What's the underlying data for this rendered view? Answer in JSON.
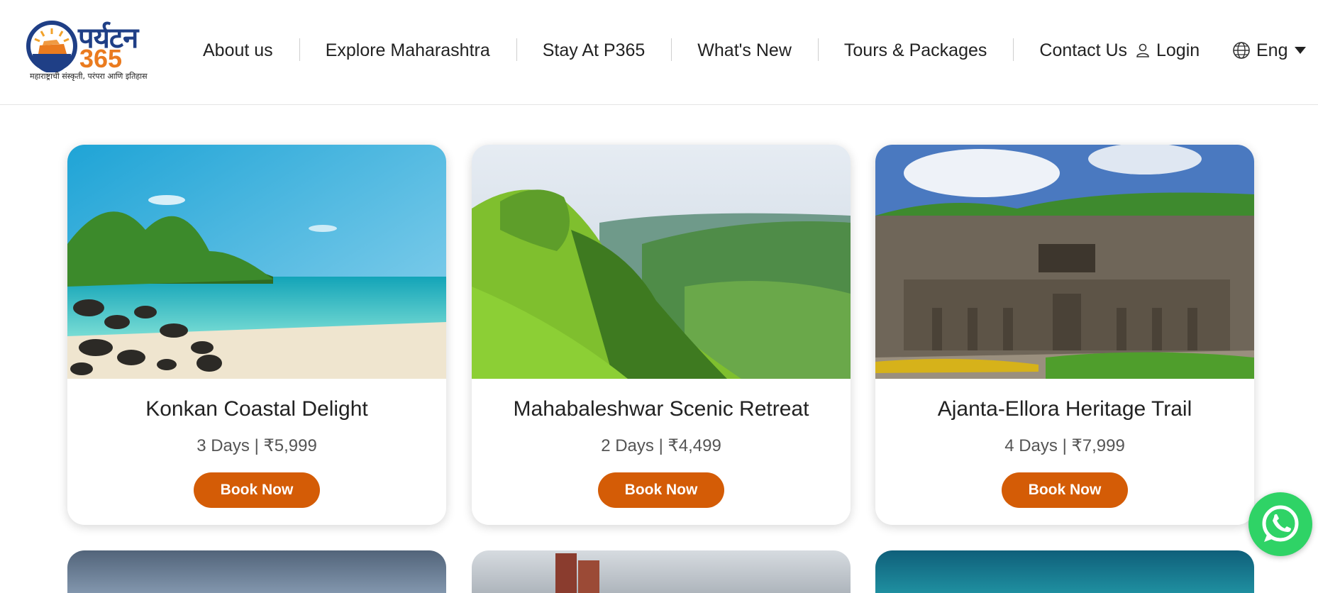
{
  "brand": {
    "title": "पर्यटन",
    "number": "365",
    "tagline": "महाराष्ट्राची संस्कृती, परंपरा आणि इतिहास",
    "colors": {
      "navy": "#1f3f86",
      "orange": "#ea7b1f"
    }
  },
  "nav": {
    "items": [
      "About us",
      "Explore Maharashtra",
      "Stay At P365",
      "What's New",
      "Tours & Packages",
      "Contact Us"
    ],
    "login": {
      "label": "Login",
      "icon": "user-icon"
    },
    "language": {
      "label": "Eng",
      "icon": "globe-icon"
    }
  },
  "cards": [
    {
      "title": "Konkan Coastal Delight",
      "meta": "3 Days | ₹5,999",
      "button": "Book Now",
      "image": "beach-photo"
    },
    {
      "title": "Mahabaleshwar Scenic Retreat",
      "meta": "2 Days | ₹4,499",
      "button": "Book Now",
      "image": "green-hills-photo"
    },
    {
      "title": "Ajanta-Ellora Heritage Trail",
      "meta": "4 Days | ₹7,999",
      "button": "Book Now",
      "image": "rock-cut-caves-photo"
    }
  ],
  "colors": {
    "button": "#d45c06",
    "whatsapp": "#2fd366"
  },
  "whatsapp": {
    "icon": "whatsapp-icon"
  }
}
